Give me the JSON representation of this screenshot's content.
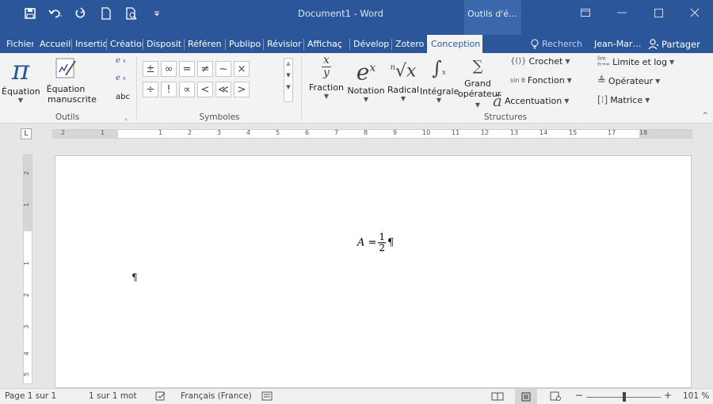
{
  "window": {
    "title": "Document1 - Word",
    "contextual_tab_label": "Outils d'é…",
    "qat": {
      "save": "save-icon",
      "undo": "undo-icon",
      "redo": "redo-icon",
      "new": "new-document-icon",
      "preview": "print-preview-icon",
      "customize": "qat-customize-icon"
    }
  },
  "tabs": [
    "Fichier",
    "Accueil",
    "Insertio",
    "Créatior",
    "Disposit",
    "Référen",
    "Publipo",
    "Révisior",
    "Affichaç",
    "Dévelop",
    "Zotero",
    "Conception"
  ],
  "active_tab": "Conception",
  "tell_me": "Recherch",
  "user": "Jean-Mar…",
  "share": "Partager",
  "ribbon": {
    "outils": {
      "label": "Outils",
      "equation": "Équation",
      "equation_manuscrite_1": "Équation",
      "equation_manuscrite_2": "manuscrite",
      "abc": "abc"
    },
    "symboles": {
      "label": "Symboles",
      "row1": [
        "±",
        "∞",
        "=",
        "≠",
        "~",
        "×"
      ],
      "row2": [
        "÷",
        "!",
        "∝",
        "<",
        "≪",
        ">"
      ]
    },
    "structures": {
      "label": "Structures",
      "fraction": "Fraction",
      "notation": "Notation",
      "radical": "Radical",
      "integrale": "Intégrale",
      "grand_1": "Grand",
      "grand_2": "opérateur",
      "crochet": "Crochet",
      "fonction": "Fonction",
      "accentuation": "Accentuation",
      "limite": "Limite et log",
      "operateur": "Opérateur",
      "matrice": "Matrice"
    }
  },
  "ruler": {
    "corner": "L",
    "ticks": [
      "2",
      "1",
      "1",
      "2",
      "3",
      "4",
      "5",
      "6",
      "7",
      "8",
      "9",
      "10",
      "11",
      "12",
      "13",
      "14",
      "15",
      "17",
      "18"
    ]
  },
  "vruler_ticks": [
    "2",
    "1",
    "1",
    "2",
    "3",
    "4",
    "5"
  ],
  "document": {
    "eq_lhs": "A =",
    "eq_num": "1",
    "eq_den": "2",
    "para_mark": "¶"
  },
  "status": {
    "page": "Page 1 sur 1",
    "words": "1 sur 1 mot",
    "language": "Français (France)",
    "zoom": "101 %",
    "zoom_minus": "−",
    "zoom_plus": "+"
  }
}
